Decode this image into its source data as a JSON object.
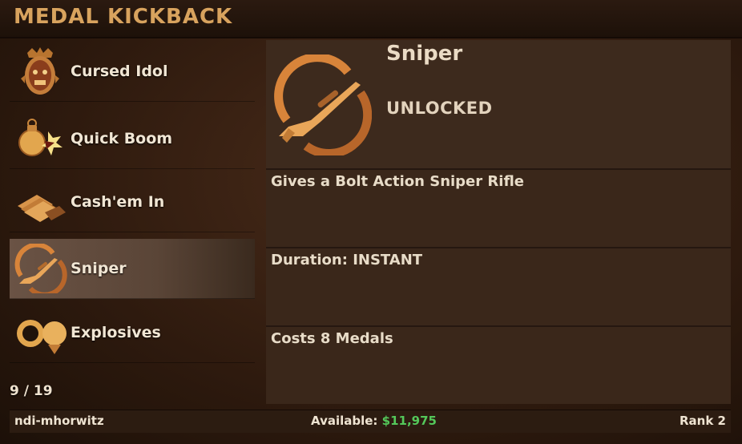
{
  "window": {
    "title": "MEDAL KICKBACK"
  },
  "sidebar": {
    "items": [
      {
        "label": "Cursed Idol",
        "icon": "cursed-idol-icon"
      },
      {
        "label": "Quick Boom",
        "icon": "grenade-icon"
      },
      {
        "label": "Cash'em In",
        "icon": "cash-icon"
      },
      {
        "label": "Sniper",
        "icon": "sniper-rifle-icon",
        "selected": true
      },
      {
        "label": "Explosives",
        "icon": "explosives-icon"
      }
    ],
    "page_count": "9 / 19"
  },
  "detail": {
    "name": "Sniper",
    "status": "UNLOCKED",
    "icon": "sniper-rifle-icon",
    "description": "Gives a Bolt Action Sniper Rifle",
    "duration": "Duration: INSTANT",
    "cost": "Costs 8 Medals"
  },
  "footer": {
    "username": "ndi-mhorwitz",
    "available_label": "Available: ",
    "available_amount": "$11,975",
    "rank": "Rank 2"
  },
  "colors": {
    "accent_gold": "#d8a35e",
    "money_green": "#54c85a",
    "selected_item": "#5a4537"
  }
}
